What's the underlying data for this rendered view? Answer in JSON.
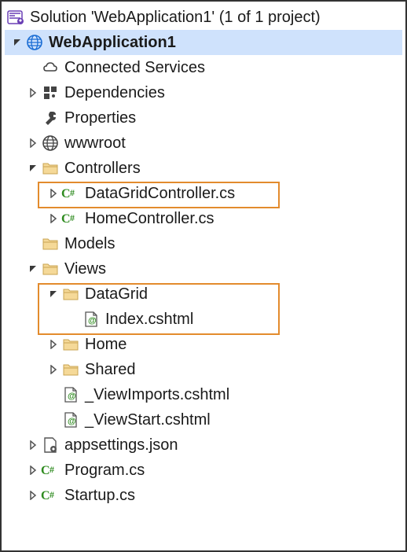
{
  "root": {
    "label": "Solution 'WebApplication1' (1 of 1 project)"
  },
  "project": {
    "label": "WebApplication1"
  },
  "nodes": {
    "connectedServices": "Connected Services",
    "dependencies": "Dependencies",
    "properties": "Properties",
    "wwwroot": "wwwroot",
    "controllers": "Controllers",
    "dataGridController": "DataGridController.cs",
    "homeController": "HomeController.cs",
    "models": "Models",
    "views": "Views",
    "dataGrid": "DataGrid",
    "index": "Index.cshtml",
    "home": "Home",
    "shared": "Shared",
    "viewImports": "_ViewImports.cshtml",
    "viewStart": "_ViewStart.cshtml",
    "appsettings": "appsettings.json",
    "program": "Program.cs",
    "startup": "Startup.cs"
  }
}
